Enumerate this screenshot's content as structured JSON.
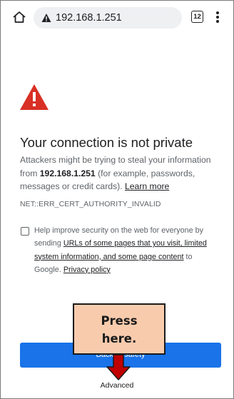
{
  "browser": {
    "url": "192.168.1.251",
    "tab_count": "12"
  },
  "interstitial": {
    "heading": "Your connection is not private",
    "explanation_before_host": "Attackers might be trying to steal your information from ",
    "host": "192.168.1.251",
    "explanation_after_host": " (for example, passwords, messages or credit cards). ",
    "learn_more": "Learn more",
    "error_code": "NET::ERR_CERT_AUTHORITY_INVALID",
    "optin_prefix": "Help improve security on the web for everyone by sending ",
    "optin_link": "URLs of some pages that you visit, limited system information, and some page content",
    "optin_middle": " to Google. ",
    "privacy_link": "Privacy policy",
    "back_button": "Back to safety",
    "advanced_button": "Advanced"
  },
  "annotation": {
    "callout_text": "Press\nhere.",
    "callout_color": "#f8cbad",
    "arrow_color": "#c00000"
  },
  "colors": {
    "warning_red": "#d93025",
    "button_blue": "#1a73e8"
  },
  "icons": {
    "home": "home-icon",
    "warning_small": "warning-triangle-icon",
    "warning_large": "red-warning-triangle-icon",
    "menu": "vertical-dots-icon",
    "arrow": "down-arrow-icon"
  }
}
